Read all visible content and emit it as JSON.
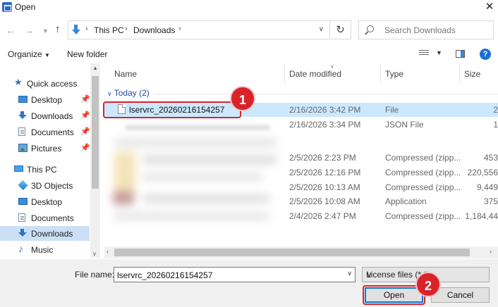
{
  "window": {
    "title": "Open"
  },
  "nav": {
    "breadcrumb": [
      "This PC",
      "Downloads"
    ],
    "search_placeholder": "Search Downloads"
  },
  "toolbar": {
    "organize": "Organize",
    "new_folder": "New folder"
  },
  "sidebar": {
    "items": [
      {
        "label": "Quick access"
      },
      {
        "label": "Desktop"
      },
      {
        "label": "Downloads"
      },
      {
        "label": "Documents"
      },
      {
        "label": "Pictures"
      },
      {
        "label": "This PC"
      },
      {
        "label": "3D Objects"
      },
      {
        "label": "Desktop"
      },
      {
        "label": "Documents"
      },
      {
        "label": "Downloads"
      },
      {
        "label": "Music"
      }
    ]
  },
  "columns": {
    "name": "Name",
    "date": "Date modified",
    "type": "Type",
    "size": "Size"
  },
  "group": {
    "label": "Today (2)"
  },
  "files": [
    {
      "name": "lservrc_20260216154257",
      "date": "2/16/2026 3:42 PM",
      "type": "File",
      "size": "2"
    },
    {
      "name": "",
      "date": "2/16/2026 3:34 PM",
      "type": "JSON File",
      "size": "1"
    },
    {
      "name": "",
      "date": "2/5/2026 2:23 PM",
      "type": "Compressed (zipp...",
      "size": "453"
    },
    {
      "name": "",
      "date": "2/5/2026 12:16 PM",
      "type": "Compressed (zipp...",
      "size": "220,556"
    },
    {
      "name": "",
      "date": "2/5/2026 10:13 AM",
      "type": "Compressed (zipp...",
      "size": "9,449"
    },
    {
      "name": "",
      "date": "2/5/2026 10:08 AM",
      "type": "Application",
      "size": "375"
    },
    {
      "name": "",
      "date": "2/4/2026 2:47 PM",
      "type": "Compressed (zipp...",
      "size": "1,184,44"
    }
  ],
  "footer": {
    "filename_label": "File name:",
    "filename_value": "lservrc_20260216154257",
    "filetype": "License files (*.*)",
    "open": "Open",
    "cancel": "Cancel"
  },
  "callouts": [
    "1",
    "2"
  ],
  "colors": {
    "accent": "#0078d7",
    "selection": "#cce8ff",
    "callout": "#d9232a"
  }
}
